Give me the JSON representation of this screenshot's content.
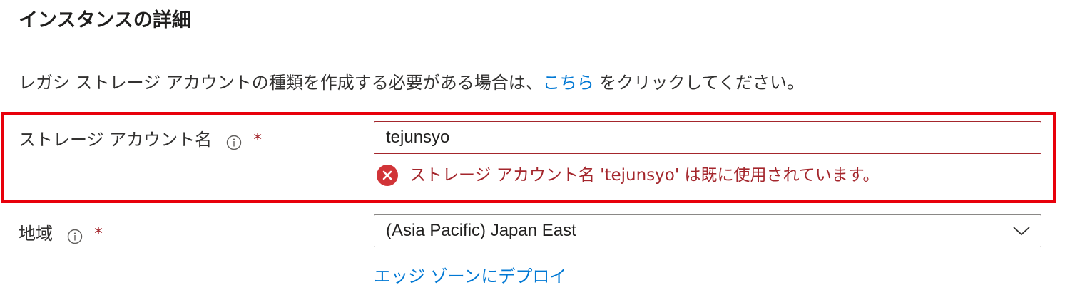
{
  "section": {
    "title": "インスタンスの詳細"
  },
  "legacy": {
    "prefix": "レガシ ストレージ アカウントの種類を作成する必要がある場合は、",
    "link": "こちら",
    "suffix": " をクリックしてください。"
  },
  "storage_account": {
    "label": "ストレージ アカウント名",
    "required_mark": "*",
    "value": "tejunsyo",
    "error": "ストレージ アカウント名 'tejunsyo' は既に使用されています。"
  },
  "region": {
    "label": "地域",
    "required_mark": "*",
    "selected": "(Asia Pacific) Japan East",
    "edge_link": "エッジ ゾーンにデプロイ"
  },
  "icons": {
    "info": "info-icon",
    "error": "error-circle-icon",
    "chevron": "chevron-down-icon"
  },
  "colors": {
    "link": "#0078d4",
    "error": "#a4262c",
    "highlight": "#e8000b",
    "error_icon": "#d13438"
  }
}
